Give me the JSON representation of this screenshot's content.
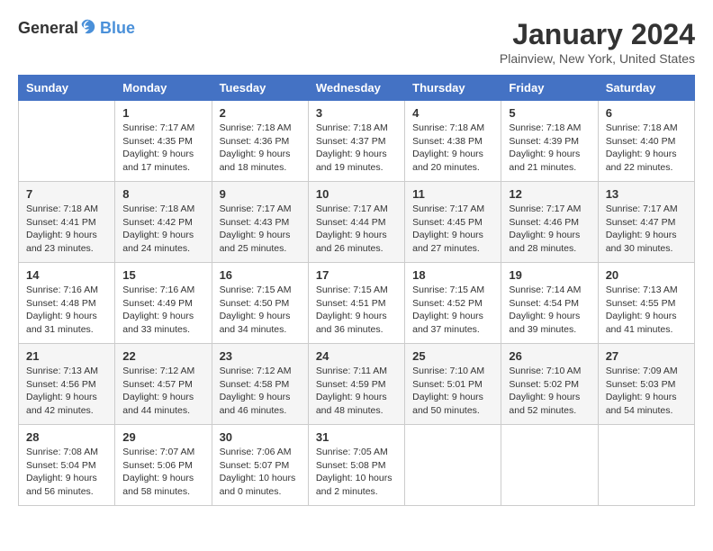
{
  "logo": {
    "text_general": "General",
    "text_blue": "Blue"
  },
  "title": {
    "month_year": "January 2024",
    "location": "Plainview, New York, United States"
  },
  "headers": [
    "Sunday",
    "Monday",
    "Tuesday",
    "Wednesday",
    "Thursday",
    "Friday",
    "Saturday"
  ],
  "weeks": [
    [
      {
        "day": "",
        "sunrise": "",
        "sunset": "",
        "daylight": ""
      },
      {
        "day": "1",
        "sunrise": "Sunrise: 7:17 AM",
        "sunset": "Sunset: 4:35 PM",
        "daylight": "Daylight: 9 hours and 17 minutes."
      },
      {
        "day": "2",
        "sunrise": "Sunrise: 7:18 AM",
        "sunset": "Sunset: 4:36 PM",
        "daylight": "Daylight: 9 hours and 18 minutes."
      },
      {
        "day": "3",
        "sunrise": "Sunrise: 7:18 AM",
        "sunset": "Sunset: 4:37 PM",
        "daylight": "Daylight: 9 hours and 19 minutes."
      },
      {
        "day": "4",
        "sunrise": "Sunrise: 7:18 AM",
        "sunset": "Sunset: 4:38 PM",
        "daylight": "Daylight: 9 hours and 20 minutes."
      },
      {
        "day": "5",
        "sunrise": "Sunrise: 7:18 AM",
        "sunset": "Sunset: 4:39 PM",
        "daylight": "Daylight: 9 hours and 21 minutes."
      },
      {
        "day": "6",
        "sunrise": "Sunrise: 7:18 AM",
        "sunset": "Sunset: 4:40 PM",
        "daylight": "Daylight: 9 hours and 22 minutes."
      }
    ],
    [
      {
        "day": "7",
        "sunrise": "Sunrise: 7:18 AM",
        "sunset": "Sunset: 4:41 PM",
        "daylight": "Daylight: 9 hours and 23 minutes."
      },
      {
        "day": "8",
        "sunrise": "Sunrise: 7:18 AM",
        "sunset": "Sunset: 4:42 PM",
        "daylight": "Daylight: 9 hours and 24 minutes."
      },
      {
        "day": "9",
        "sunrise": "Sunrise: 7:17 AM",
        "sunset": "Sunset: 4:43 PM",
        "daylight": "Daylight: 9 hours and 25 minutes."
      },
      {
        "day": "10",
        "sunrise": "Sunrise: 7:17 AM",
        "sunset": "Sunset: 4:44 PM",
        "daylight": "Daylight: 9 hours and 26 minutes."
      },
      {
        "day": "11",
        "sunrise": "Sunrise: 7:17 AM",
        "sunset": "Sunset: 4:45 PM",
        "daylight": "Daylight: 9 hours and 27 minutes."
      },
      {
        "day": "12",
        "sunrise": "Sunrise: 7:17 AM",
        "sunset": "Sunset: 4:46 PM",
        "daylight": "Daylight: 9 hours and 28 minutes."
      },
      {
        "day": "13",
        "sunrise": "Sunrise: 7:17 AM",
        "sunset": "Sunset: 4:47 PM",
        "daylight": "Daylight: 9 hours and 30 minutes."
      }
    ],
    [
      {
        "day": "14",
        "sunrise": "Sunrise: 7:16 AM",
        "sunset": "Sunset: 4:48 PM",
        "daylight": "Daylight: 9 hours and 31 minutes."
      },
      {
        "day": "15",
        "sunrise": "Sunrise: 7:16 AM",
        "sunset": "Sunset: 4:49 PM",
        "daylight": "Daylight: 9 hours and 33 minutes."
      },
      {
        "day": "16",
        "sunrise": "Sunrise: 7:15 AM",
        "sunset": "Sunset: 4:50 PM",
        "daylight": "Daylight: 9 hours and 34 minutes."
      },
      {
        "day": "17",
        "sunrise": "Sunrise: 7:15 AM",
        "sunset": "Sunset: 4:51 PM",
        "daylight": "Daylight: 9 hours and 36 minutes."
      },
      {
        "day": "18",
        "sunrise": "Sunrise: 7:15 AM",
        "sunset": "Sunset: 4:52 PM",
        "daylight": "Daylight: 9 hours and 37 minutes."
      },
      {
        "day": "19",
        "sunrise": "Sunrise: 7:14 AM",
        "sunset": "Sunset: 4:54 PM",
        "daylight": "Daylight: 9 hours and 39 minutes."
      },
      {
        "day": "20",
        "sunrise": "Sunrise: 7:13 AM",
        "sunset": "Sunset: 4:55 PM",
        "daylight": "Daylight: 9 hours and 41 minutes."
      }
    ],
    [
      {
        "day": "21",
        "sunrise": "Sunrise: 7:13 AM",
        "sunset": "Sunset: 4:56 PM",
        "daylight": "Daylight: 9 hours and 42 minutes."
      },
      {
        "day": "22",
        "sunrise": "Sunrise: 7:12 AM",
        "sunset": "Sunset: 4:57 PM",
        "daylight": "Daylight: 9 hours and 44 minutes."
      },
      {
        "day": "23",
        "sunrise": "Sunrise: 7:12 AM",
        "sunset": "Sunset: 4:58 PM",
        "daylight": "Daylight: 9 hours and 46 minutes."
      },
      {
        "day": "24",
        "sunrise": "Sunrise: 7:11 AM",
        "sunset": "Sunset: 4:59 PM",
        "daylight": "Daylight: 9 hours and 48 minutes."
      },
      {
        "day": "25",
        "sunrise": "Sunrise: 7:10 AM",
        "sunset": "Sunset: 5:01 PM",
        "daylight": "Daylight: 9 hours and 50 minutes."
      },
      {
        "day": "26",
        "sunrise": "Sunrise: 7:10 AM",
        "sunset": "Sunset: 5:02 PM",
        "daylight": "Daylight: 9 hours and 52 minutes."
      },
      {
        "day": "27",
        "sunrise": "Sunrise: 7:09 AM",
        "sunset": "Sunset: 5:03 PM",
        "daylight": "Daylight: 9 hours and 54 minutes."
      }
    ],
    [
      {
        "day": "28",
        "sunrise": "Sunrise: 7:08 AM",
        "sunset": "Sunset: 5:04 PM",
        "daylight": "Daylight: 9 hours and 56 minutes."
      },
      {
        "day": "29",
        "sunrise": "Sunrise: 7:07 AM",
        "sunset": "Sunset: 5:06 PM",
        "daylight": "Daylight: 9 hours and 58 minutes."
      },
      {
        "day": "30",
        "sunrise": "Sunrise: 7:06 AM",
        "sunset": "Sunset: 5:07 PM",
        "daylight": "Daylight: 10 hours and 0 minutes."
      },
      {
        "day": "31",
        "sunrise": "Sunrise: 7:05 AM",
        "sunset": "Sunset: 5:08 PM",
        "daylight": "Daylight: 10 hours and 2 minutes."
      },
      {
        "day": "",
        "sunrise": "",
        "sunset": "",
        "daylight": ""
      },
      {
        "day": "",
        "sunrise": "",
        "sunset": "",
        "daylight": ""
      },
      {
        "day": "",
        "sunrise": "",
        "sunset": "",
        "daylight": ""
      }
    ]
  ]
}
